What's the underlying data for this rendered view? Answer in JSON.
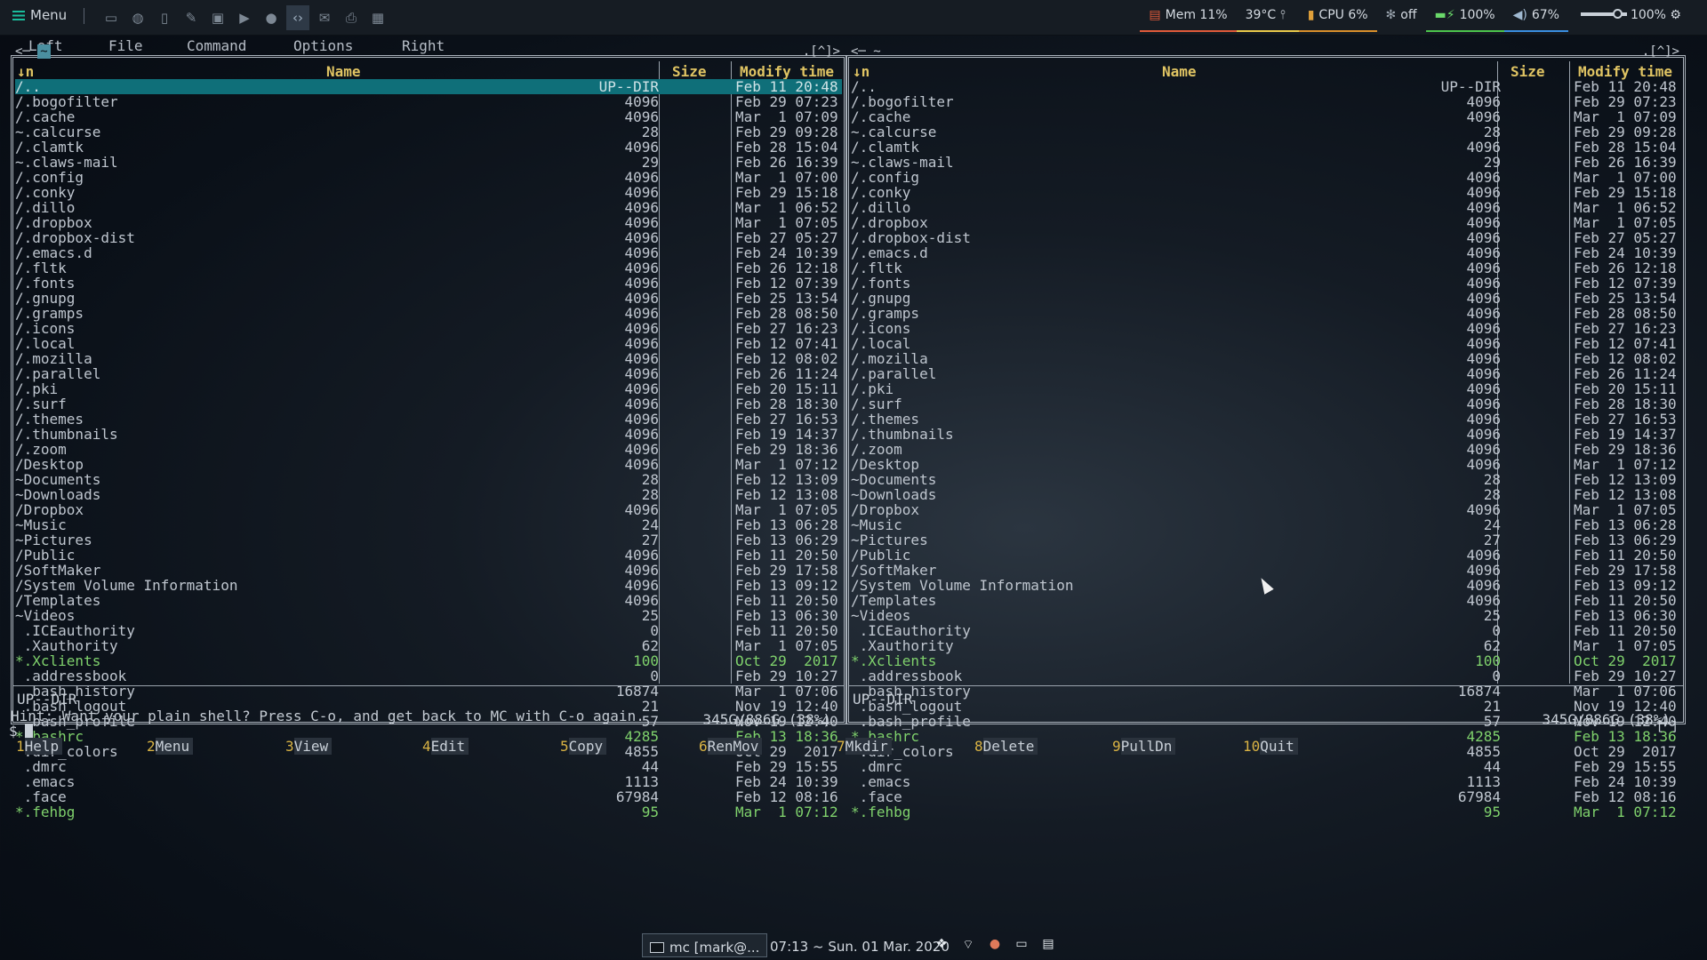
{
  "top_panel": {
    "menu_label": "Menu",
    "launcher_icons": [
      "terminal-icon",
      "globe-icon",
      "file-icon",
      "edit-icon",
      "image-icon",
      "video-icon",
      "mic-icon",
      "code-icon",
      "mail-icon",
      "print-icon",
      "grid-icon"
    ],
    "mem": "Mem 11%",
    "temp": "39°C",
    "cpu": "CPU 6%",
    "fan": "off",
    "battery": "100%",
    "volume": "67%",
    "brightness": "100%"
  },
  "mc": {
    "menubar": [
      "Left",
      "File",
      "Command",
      "Options",
      "Right"
    ],
    "left_panel": {
      "path_label": "~",
      "topright": ".[^]>",
      "headers": {
        "sort": "↓n",
        "name": "Name",
        "size": "Size",
        "mtime": "Modify time"
      },
      "status": "UP--DIR",
      "free": "345G/886G (38%)"
    },
    "right_panel": {
      "path_label": "~",
      "topright": ".[^]>",
      "headers": {
        "sort": "↓n",
        "name": "Name",
        "size": "Size",
        "mtime": "Modify time"
      },
      "status": "UP--DIR",
      "free": "345G/886G (38%)"
    },
    "files": [
      {
        "name": "/..",
        "size": "UP--DIR",
        "mtime": "Feb 11 20:48"
      },
      {
        "name": "/.bogofilter",
        "size": "4096",
        "mtime": "Feb 29 07:23"
      },
      {
        "name": "/.cache",
        "size": "4096",
        "mtime": "Mar  1 07:09"
      },
      {
        "name": "~.calcurse",
        "size": "28",
        "mtime": "Feb 29 09:28"
      },
      {
        "name": "/.clamtk",
        "size": "4096",
        "mtime": "Feb 28 15:04"
      },
      {
        "name": "~.claws-mail",
        "size": "29",
        "mtime": "Feb 26 16:39"
      },
      {
        "name": "/.config",
        "size": "4096",
        "mtime": "Mar  1 07:00"
      },
      {
        "name": "/.conky",
        "size": "4096",
        "mtime": "Feb 29 15:18"
      },
      {
        "name": "/.dillo",
        "size": "4096",
        "mtime": "Mar  1 06:52"
      },
      {
        "name": "/.dropbox",
        "size": "4096",
        "mtime": "Mar  1 07:05"
      },
      {
        "name": "/.dropbox-dist",
        "size": "4096",
        "mtime": "Feb 27 05:27"
      },
      {
        "name": "/.emacs.d",
        "size": "4096",
        "mtime": "Feb 24 10:39"
      },
      {
        "name": "/.fltk",
        "size": "4096",
        "mtime": "Feb 26 12:18"
      },
      {
        "name": "/.fonts",
        "size": "4096",
        "mtime": "Feb 12 07:39"
      },
      {
        "name": "/.gnupg",
        "size": "4096",
        "mtime": "Feb 25 13:54"
      },
      {
        "name": "/.gramps",
        "size": "4096",
        "mtime": "Feb 28 08:50"
      },
      {
        "name": "/.icons",
        "size": "4096",
        "mtime": "Feb 27 16:23"
      },
      {
        "name": "/.local",
        "size": "4096",
        "mtime": "Feb 12 07:41"
      },
      {
        "name": "/.mozilla",
        "size": "4096",
        "mtime": "Feb 12 08:02"
      },
      {
        "name": "/.parallel",
        "size": "4096",
        "mtime": "Feb 26 11:24"
      },
      {
        "name": "/.pki",
        "size": "4096",
        "mtime": "Feb 20 15:11"
      },
      {
        "name": "/.surf",
        "size": "4096",
        "mtime": "Feb 28 18:30"
      },
      {
        "name": "/.themes",
        "size": "4096",
        "mtime": "Feb 27 16:53"
      },
      {
        "name": "/.thumbnails",
        "size": "4096",
        "mtime": "Feb 19 14:37"
      },
      {
        "name": "/.zoom",
        "size": "4096",
        "mtime": "Feb 29 18:36"
      },
      {
        "name": "/Desktop",
        "size": "4096",
        "mtime": "Mar  1 07:12"
      },
      {
        "name": "~Documents",
        "size": "28",
        "mtime": "Feb 12 13:09"
      },
      {
        "name": "~Downloads",
        "size": "28",
        "mtime": "Feb 12 13:08"
      },
      {
        "name": "/Dropbox",
        "size": "4096",
        "mtime": "Mar  1 07:05"
      },
      {
        "name": "~Music",
        "size": "24",
        "mtime": "Feb 13 06:28"
      },
      {
        "name": "~Pictures",
        "size": "27",
        "mtime": "Feb 13 06:29"
      },
      {
        "name": "/Public",
        "size": "4096",
        "mtime": "Feb 11 20:50"
      },
      {
        "name": "/SoftMaker",
        "size": "4096",
        "mtime": "Feb 29 17:58"
      },
      {
        "name": "/System Volume Information",
        "size": "4096",
        "mtime": "Feb 13 09:12"
      },
      {
        "name": "/Templates",
        "size": "4096",
        "mtime": "Feb 11 20:50"
      },
      {
        "name": "~Videos",
        "size": "25",
        "mtime": "Feb 13 06:30"
      },
      {
        "name": " .ICEauthority",
        "size": "0",
        "mtime": "Feb 11 20:50"
      },
      {
        "name": " .Xauthority",
        "size": "62",
        "mtime": "Mar  1 07:05"
      },
      {
        "name": "*.Xclients",
        "size": "100",
        "mtime": "Oct 29  2017",
        "exec": true
      },
      {
        "name": " .addressbook",
        "size": "0",
        "mtime": "Feb 29 10:27"
      },
      {
        "name": " .bash_history",
        "size": "16874",
        "mtime": "Mar  1 07:06"
      },
      {
        "name": " .bash_logout",
        "size": "21",
        "mtime": "Nov 19 12:40"
      },
      {
        "name": " .bash_profile",
        "size": "57",
        "mtime": "Nov 19 12:40"
      },
      {
        "name": "*.bashrc",
        "size": "4285",
        "mtime": "Feb 13 18:36",
        "exec": true
      },
      {
        "name": " .dir_colors",
        "size": "4855",
        "mtime": "Oct 29  2017"
      },
      {
        "name": " .dmrc",
        "size": "44",
        "mtime": "Feb 29 15:55"
      },
      {
        "name": " .emacs",
        "size": "1113",
        "mtime": "Feb 24 10:39"
      },
      {
        "name": " .face",
        "size": "67984",
        "mtime": "Feb 12 08:16"
      },
      {
        "name": "*.fehbg",
        "size": "95",
        "mtime": "Mar  1 07:12",
        "exec": true
      }
    ],
    "hint": "Hint: Want your plain shell? Press C-o, and get back to MC with C-o again.",
    "prompt": "$",
    "corner": "[^]",
    "fkeys": [
      {
        "num": "1",
        "label": "Help"
      },
      {
        "num": "2",
        "label": "Menu"
      },
      {
        "num": "3",
        "label": "View"
      },
      {
        "num": "4",
        "label": "Edit"
      },
      {
        "num": "5",
        "label": "Copy"
      },
      {
        "num": "6",
        "label": "RenMov"
      },
      {
        "num": "7",
        "label": "Mkdir"
      },
      {
        "num": "8",
        "label": "Delete"
      },
      {
        "num": "9",
        "label": "PullDn"
      },
      {
        "num": "10",
        "label": "Quit"
      }
    ]
  },
  "taskbar": {
    "task_label": "mc [mark@...",
    "clock": "07:13 ~ Sun. 01 Mar. 2020",
    "tray_icons": [
      "dropbox-icon",
      "wifi-icon",
      "color-icon",
      "drive-icon",
      "clipboard-icon"
    ]
  }
}
